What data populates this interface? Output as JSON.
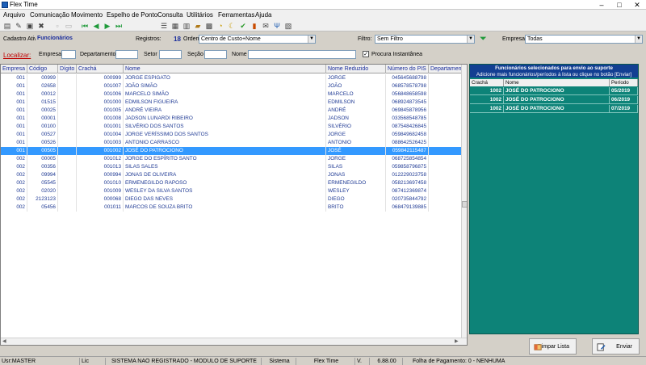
{
  "window": {
    "title": "Flex Time",
    "min": "–",
    "max": "□",
    "close": "✕"
  },
  "menu": [
    "Arquivo",
    "Comunicação",
    "Movimento",
    "Espelho de Ponto",
    "Consulta",
    "Utilitários",
    "Ferramentas",
    "Ajuda"
  ],
  "filters": {
    "cadastro_label": "Cadastro Ativo:",
    "cadastro_value": "Funcionários",
    "registros_label": "Registros:",
    "registros_value": "18",
    "ordem_label": "Ordem",
    "ordem_value": "Centro de Custo+Nome",
    "filtro_label": "Filtro:",
    "filtro_value": "Sem Filtro",
    "empresa_label": "Empresa:",
    "empresa_value": "Todas"
  },
  "localizar": {
    "label": "Localizar:",
    "empresa": "Empresa",
    "departamento": "Departamento",
    "setor": "Setor",
    "secao": "Seção",
    "nome": "Nome",
    "procura_label": "Procura Instantânea",
    "procura_checked": true
  },
  "grid": {
    "columns": [
      "Empresa",
      "Código",
      "Dígito",
      "Crachá",
      "Nome",
      "Nome Reduzido",
      "Número do PIS",
      "Departamen"
    ],
    "rows": [
      [
        "001",
        "00999",
        "",
        "000999",
        "JORGE ESPIGATO",
        "JORGE",
        "045645688798"
      ],
      [
        "001",
        "02658",
        "",
        "001007",
        "JOÃO SIMÃO",
        "JOÃO",
        "068578578798"
      ],
      [
        "001",
        "00012",
        "",
        "001006",
        "MARCELO SIMÃO",
        "MARCELO",
        "056848658598"
      ],
      [
        "001",
        "01515",
        "",
        "001000",
        "EDMILSON FIGUEIRA",
        "EDMILSON",
        "068924873545"
      ],
      [
        "001",
        "00025",
        "",
        "001005",
        "ANDRÉ VIEIRA",
        "ANDRÉ",
        "069845878956"
      ],
      [
        "001",
        "00001",
        "",
        "001008",
        "JADSON LUNARDI RIBEIRO",
        "JADSON",
        "033568548785"
      ],
      [
        "001",
        "00100",
        "",
        "001001",
        "SILVÉRIO DOS SANTOS",
        "SILVÉRIO",
        "087548426845"
      ],
      [
        "001",
        "00527",
        "",
        "001004",
        "JORGE VERÍSSIMO DOS SANTOS",
        "JORGE",
        "059849682458"
      ],
      [
        "001",
        "00526",
        "",
        "001003",
        "ANTONIO CARRASCO",
        "ANTONIO",
        "088642526425"
      ],
      [
        "001",
        "00505",
        "",
        "001002",
        "JOSÉ DO PATROCIONO",
        "JOSÉ",
        "059842115487"
      ],
      [
        "002",
        "00005",
        "",
        "001012",
        "JORGE DO ESPÍRITO SANTO",
        "JORGE",
        "068725854854"
      ],
      [
        "002",
        "00356",
        "",
        "001013",
        "SILAS SALES",
        "SILAS",
        "059858796875"
      ],
      [
        "002",
        "09994",
        "",
        "000994",
        "JONAS DE OLIVEIRA",
        "JONAS",
        "012229023758"
      ],
      [
        "002",
        "05545",
        "",
        "001010",
        "ERMENEGILDO RAPOSO",
        "ERMENEGILDO",
        "058213697458"
      ],
      [
        "002",
        "02020",
        "",
        "001009",
        "WESLEY DA SILVA SANTOS",
        "WESLEY",
        "087412369874"
      ],
      [
        "002",
        "2123123",
        "",
        "000068",
        "DIEGO DAS NEVES",
        "DIEGO",
        "020735844792"
      ],
      [
        "002",
        "05456",
        "",
        "001011",
        "MARCOS DE SOUZA BRITO",
        "BRITO",
        "068479139885"
      ]
    ],
    "selected_index": 9
  },
  "panel": {
    "title": "Funcionários selecionados para envio ao suporte",
    "subtitle": "Adicione mais funcionários/períodos à lista ou clique no botão [Enviar]",
    "columns": [
      "Crachá",
      "Nome",
      "Período"
    ],
    "rows": [
      [
        "1002",
        "JOSÉ DO PATROCIONO",
        "05/2019"
      ],
      [
        "1002",
        "JOSÉ DO PATROCIONO",
        "06/2019"
      ],
      [
        "1002",
        "JOSÉ DO PATROCIONO",
        "07/2019"
      ]
    ]
  },
  "buttons": {
    "limpar": "Limpar Lista",
    "enviar": "Enviar"
  },
  "status": {
    "user": "Usr:MASTER",
    "lic": "Lic",
    "registro": "SISTEMA NAO REGISTRADO - MODULO DE SUPORTE",
    "sistema_label": "Sistema",
    "sistema_value": "Flex Time",
    "versao_label": "V.",
    "versao_value": "6.88.00",
    "folha": "Folha de Pagamento: 0 - NENHUMA"
  }
}
